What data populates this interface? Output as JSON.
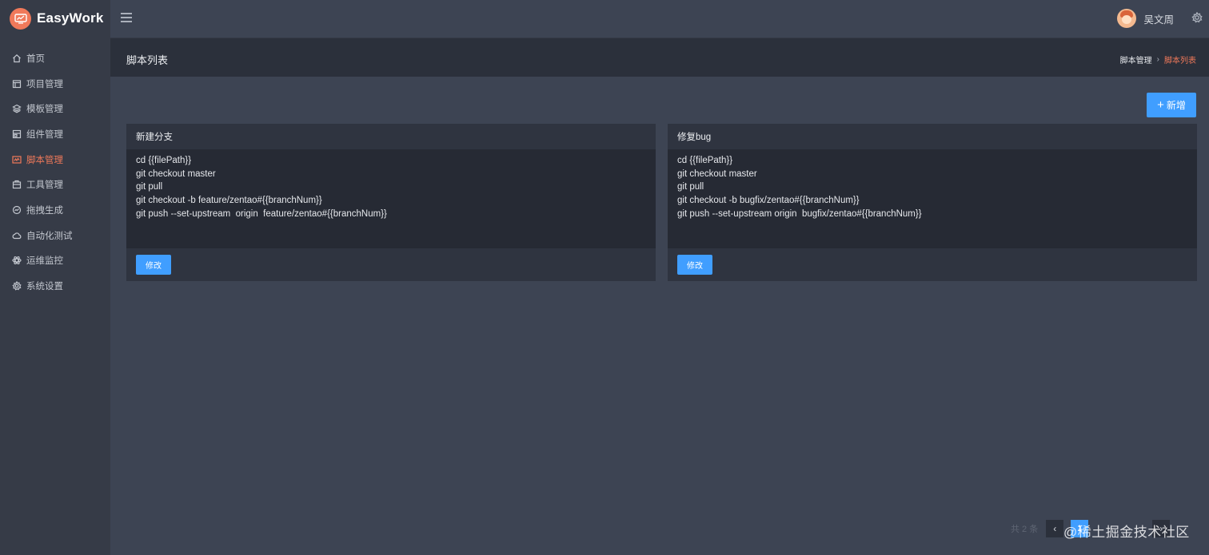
{
  "app": {
    "logo_text": "EasyWork",
    "accent": "#f0795a",
    "primary": "#409eff"
  },
  "sidebar": {
    "items": [
      {
        "label": "首页",
        "icon": "home-icon"
      },
      {
        "label": "项目管理",
        "icon": "project-icon"
      },
      {
        "label": "模板管理",
        "icon": "layers-icon"
      },
      {
        "label": "组件管理",
        "icon": "component-icon"
      },
      {
        "label": "脚本管理",
        "icon": "script-icon",
        "active": true
      },
      {
        "label": "工具管理",
        "icon": "toolbox-icon"
      },
      {
        "label": "拖拽生成",
        "icon": "drag-icon"
      },
      {
        "label": "自动化测试",
        "icon": "cloud-icon"
      },
      {
        "label": "运维监控",
        "icon": "atom-icon"
      },
      {
        "label": "系统设置",
        "icon": "gear-icon"
      }
    ]
  },
  "header": {
    "user_name": "吴文周"
  },
  "page": {
    "title": "脚本列表",
    "breadcrumb": {
      "parent": "脚本管理",
      "current": "脚本列表"
    },
    "add_label": "新增"
  },
  "cards": [
    {
      "title": "新建分支",
      "lines": [
        "cd {{filePath}}",
        "git checkout master",
        "git pull",
        "git checkout -b feature/zentao#{{branchNum}}",
        "git push --set-upstream  origin  feature/zentao#{{branchNum}}"
      ],
      "edit_label": "修改"
    },
    {
      "title": "修复bug",
      "lines": [
        "cd {{filePath}}",
        "git checkout master",
        "git pull",
        "git checkout -b bugfix/zentao#{{branchNum}}",
        "git push --set-upstream origin  bugfix/zentao#{{branchNum}}"
      ],
      "edit_label": "修改"
    }
  ],
  "pagination": {
    "total_text": "共 2 条",
    "current_page": "1",
    "prev": "‹",
    "next": "›"
  },
  "watermark": "@稀土掘金技术社区"
}
